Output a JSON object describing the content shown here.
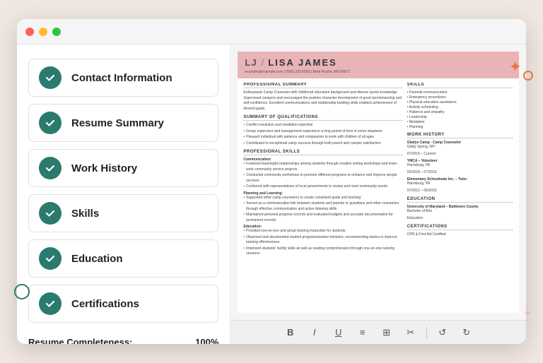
{
  "browser": {
    "dots": [
      "red",
      "yellow",
      "green"
    ]
  },
  "checklist": {
    "items": [
      {
        "label": "Contact Information",
        "id": "contact-information",
        "checked": true
      },
      {
        "label": "Resume Summary",
        "id": "resume-summary",
        "checked": true
      },
      {
        "label": "Work History",
        "id": "work-history",
        "checked": true
      },
      {
        "label": "Skills",
        "id": "skills",
        "checked": true
      },
      {
        "label": "Education",
        "id": "education",
        "checked": true
      },
      {
        "label": "Certifications",
        "id": "certifications",
        "checked": true
      }
    ],
    "completeness_label": "Resume Completeness:",
    "completeness_pct": "100%",
    "progress": 100
  },
  "resume": {
    "initials": "LJ",
    "divider": "/",
    "fullname": "LISA JAMES",
    "contact": "example@example.com  |  (555) 333-5555  |  Belle Prairie, MN 56671",
    "sections": {
      "professional_summary": {
        "title": "PROFESSIONAL SUMMARY",
        "text": "Enthusiastic Camp Counselor with childhood education background and diverse sports knowledge. Supervised campers and encouraged the positive character development of good sportsmanship and self-confidence. Excellent communications and relationship-building skills enabled achievement of desired goals."
      },
      "qualifications": {
        "title": "SUMMARY OF QUALIFICATIONS",
        "bullets": [
          "Conflict resolution and mediation expertise",
          "Group supervision and management experience a long period of time in some situations",
          "Pleasant individual with patience and compassion to work with children of all ages",
          "Contributed to exceptional camp success through both parent and camper satisfaction"
        ]
      },
      "professional_skills": {
        "title": "PROFESSIONAL SKILLS",
        "subsections": [
          {
            "name": "Communication:",
            "bullets": [
              "Fostered meaningful relationships among students through creative writing workshops and team-work community service projects",
              "Conducted community workshops to promote different programs to enhance and improve people services",
              "Conferred with representatives of local governments to review and meet community needs"
            ]
          },
          {
            "name": "Planning and Learning:",
            "bullets": [
              "Supported other camp counselors to create consistent goals and learning",
              "Served as a communication link between students and parents or guardians and other counselors through effective communication and active listening skills",
              "Maintained personal progress records and evaluated budgets and accurate documentation for permanent records"
            ]
          },
          {
            "name": "Education:",
            "bullets": [
              "Provided one-on-one and group tutoring instruction for students",
              "Observed and documented student programs/worker behavior, recommending tactics to improve tutoring effectiveness",
              "Improved students' facility skills as well as reading comprehension through one-on-one tutoring sessions"
            ]
          }
        ]
      },
      "skills": {
        "title": "SKILLS",
        "items": [
          "Parental communication",
          "Emergency procedures",
          "Physical education assistance",
          "Activity scheduling",
          "Patience and empathy",
          "Leadership",
          "Mediation",
          "Planning"
        ]
      },
      "work_history": {
        "title": "WORK HISTORY",
        "jobs": [
          {
            "title": "Glady Camp - Camp Counselor",
            "location": "Glady Spring, WV",
            "dates": "07/2019 - Current"
          },
          {
            "title": "YMCA - Volunteer",
            "location": "Harrisburg, PA",
            "dates": "02/2018 - 07/2019"
          },
          {
            "title": "Elementary Schoolmate Inc. - Tutor",
            "location": "Harrisburg, PA",
            "dates": "07/2013 - 06/2016"
          }
        ]
      },
      "education": {
        "title": "EDUCATION",
        "schools": [
          {
            "name": "University of Maryland - Baltimore County",
            "degree": "Bachelor of Arts",
            "field": "Education"
          }
        ]
      },
      "certifications": {
        "title": "CERTIFICATIONS",
        "items": [
          "CPR & First Aid Certified"
        ]
      }
    }
  },
  "toolbar": {
    "buttons": [
      "B",
      "I",
      "U",
      "≡",
      "⊞",
      "✂",
      "|",
      "↺",
      "↻"
    ]
  }
}
